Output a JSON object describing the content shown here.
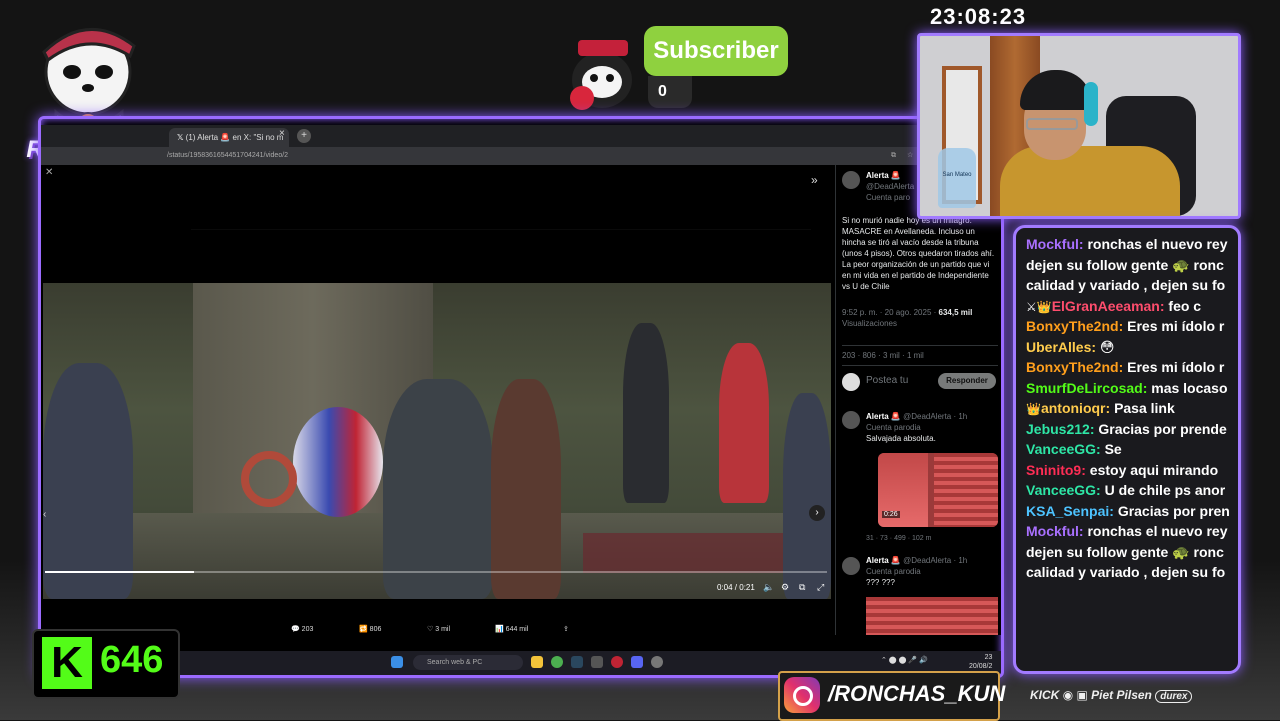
{
  "overlay": {
    "clock": "23:08:23",
    "streamer_logo": "RONCHAS",
    "subscriber": {
      "label": "Subscriber",
      "count": "0"
    },
    "kick_followers": "646",
    "kick_logo_letter": "K",
    "instagram_handle": "/RONCHAS_KUN",
    "sponsors": [
      "KICK",
      "Piet",
      "Pilsen",
      "durex"
    ],
    "webcam_bottle_label": "San Mateo",
    "colors": {
      "frame": "#9b6bff",
      "subscriber": "#8fd13f",
      "kick_green": "#53fc18"
    }
  },
  "browser": {
    "tab_title": "(1) Alerta 🚨 en X: \"Si no m",
    "tab_close": "×",
    "new_tab": "+",
    "url": "/status/1958361654451704241/video/2"
  },
  "video": {
    "time": "0:04 / 0:21",
    "progress": 0.19,
    "controls": [
      "volume-icon",
      "settings-icon",
      "fullscreen-icon"
    ]
  },
  "tweet_actions": {
    "replies": "203",
    "reposts": "806",
    "likes": "3 mil",
    "views": "644 mil"
  },
  "post": {
    "author": "Alerta 🚨",
    "handle": "@DeadAlerta",
    "parody": "Cuenta paro",
    "text": "Si no murió nadie hoy es un milagro. MASACRE en Avellaneda. Incluso un hincha se tiró al vacío desde la tribuna (unos 4 pisos). Otros quedaron tirados ahí.  La peor organización de un partido que vi en mi vida en el partido de Independiente vs U de Chile",
    "time": "9:52 p. m. · 20 ago. 2025 · ",
    "views": "634,5 mil",
    "views_label": "Visualizaciones",
    "stats": {
      "replies": "203",
      "reposts": "806",
      "likes": "3 mil",
      "bookmarks": "1 mil"
    },
    "reply_placeholder": "Postea tu",
    "reply_button": "Responder"
  },
  "replies": [
    {
      "author": "Alerta 🚨",
      "handle": "@DeadAlerta · 1h",
      "parody": "Cuenta parodia",
      "text": "Salvajada absoluta.",
      "media_time": "0:26",
      "stats": [
        "31",
        "73",
        "499",
        "102 m"
      ]
    },
    {
      "author": "Alerta 🚨",
      "handle": "@DeadAlerta · 1h",
      "parody": "Cuenta parodia",
      "text": "??? ???"
    }
  ],
  "taskbar": {
    "search": "Search web & PC",
    "time": "23",
    "date": "20/08/2"
  },
  "chat": [
    {
      "user": "Mockful:",
      "color": "#a970ff",
      "text": "ronchas el nuevo rey"
    },
    {
      "user": "",
      "color": "#ffffff",
      "text": "dejen su follow gente 🐢 ronc"
    },
    {
      "user": "",
      "color": "#ffffff",
      "text": "calidad y variado , dejen su fo"
    },
    {
      "user": "ElGranAeeaman:",
      "color": "#ff4d6d",
      "text": "feo c",
      "badges": "⚔👑"
    },
    {
      "user": "BonxyThe2nd:",
      "color": "#ff9f1c",
      "text": "Eres mi ídolo r"
    },
    {
      "user": "UberAlles:",
      "color": "#ffcc4d",
      "text": "😳"
    },
    {
      "user": "BonxyThe2nd:",
      "color": "#ff9f1c",
      "text": "Eres mi ídolo r"
    },
    {
      "user": "SmurfDeLircosad:",
      "color": "#53fc18",
      "text": "mas locaso"
    },
    {
      "user": "antonioqr:",
      "color": "#ffcc4d",
      "text": "Pasa link",
      "badges": "👑"
    },
    {
      "user": "Jebus212:",
      "color": "#2ee6a6",
      "text": "Gracias por prende"
    },
    {
      "user": "VanceeGG:",
      "color": "#2ee6a6",
      "text": "Se"
    },
    {
      "user": "Sninito9:",
      "color": "#ff2d55",
      "text": "estoy aqui mirando"
    },
    {
      "user": "VanceeGG:",
      "color": "#2ee6a6",
      "text": "U de chile ps anor"
    },
    {
      "user": "KSA_Senpai:",
      "color": "#4dc3ff",
      "text": "Gracias por pren"
    },
    {
      "user": "Mockful:",
      "color": "#a970ff",
      "text": "ronchas el nuevo rey"
    },
    {
      "user": "",
      "color": "#ffffff",
      "text": "dejen su follow gente 🐢 ronc"
    },
    {
      "user": "",
      "color": "#ffffff",
      "text": "calidad y variado , dejen su fo"
    }
  ]
}
